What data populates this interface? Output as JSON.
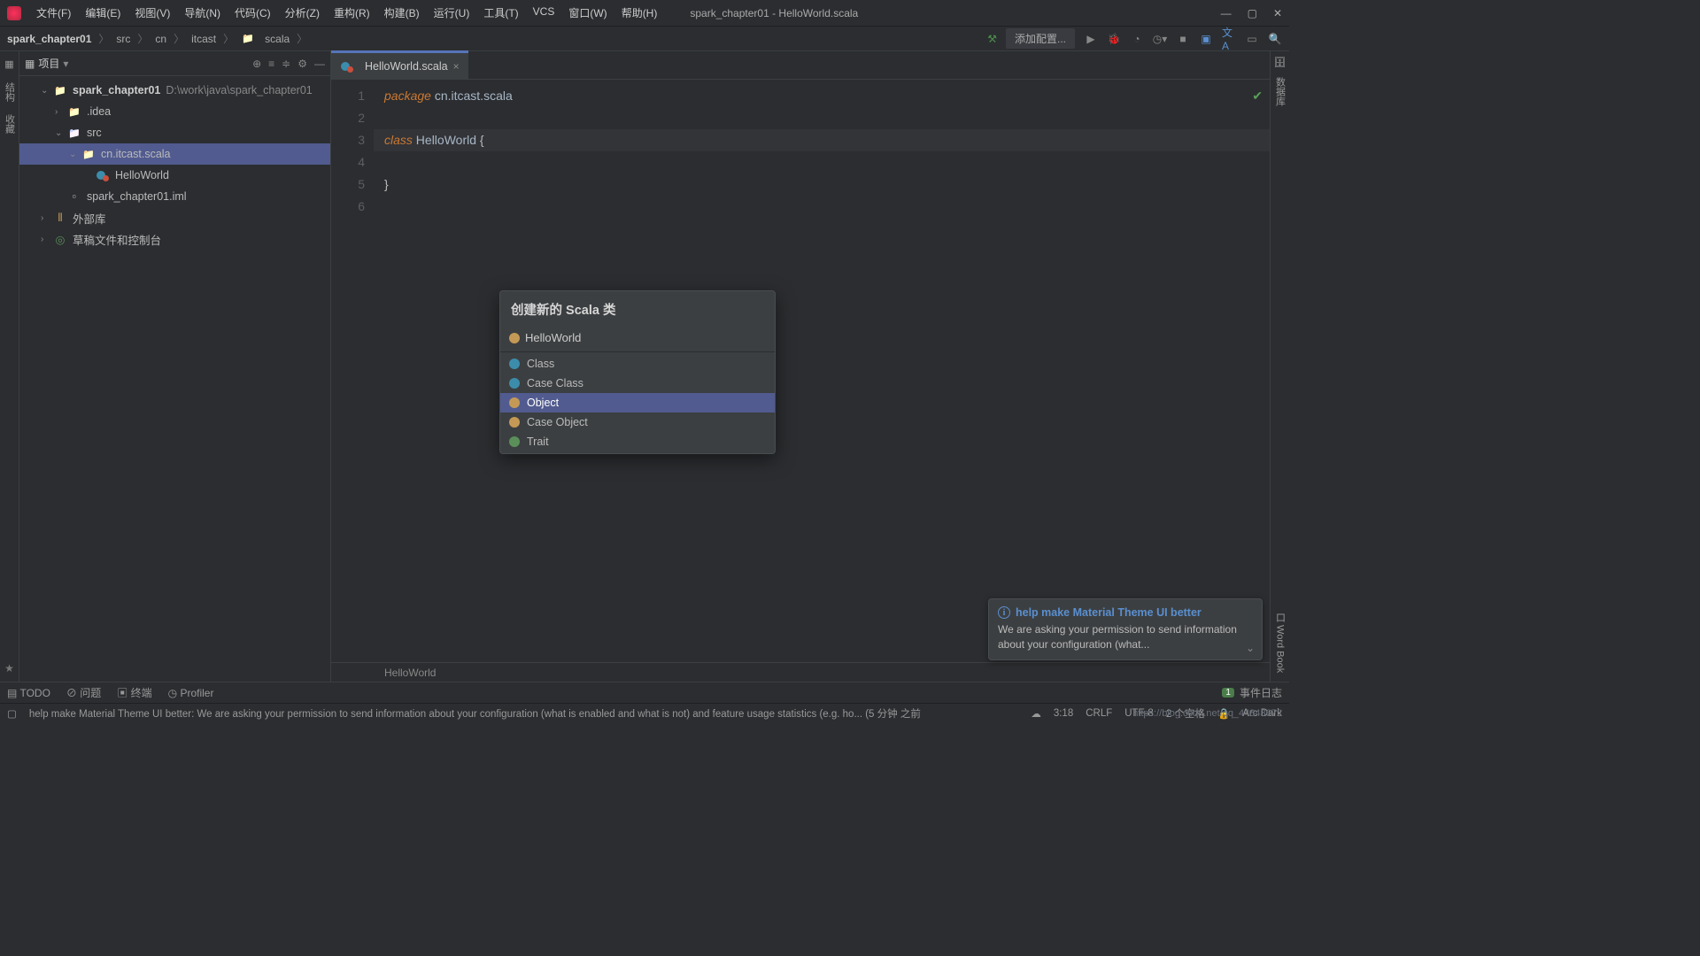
{
  "menubar": [
    "文件(F)",
    "编辑(E)",
    "视图(V)",
    "导航(N)",
    "代码(C)",
    "分析(Z)",
    "重构(R)",
    "构建(B)",
    "运行(U)",
    "工具(T)",
    "VCS",
    "窗口(W)",
    "帮助(H)"
  ],
  "window_title": "spark_chapter01 - HelloWorld.scala",
  "breadcrumb": [
    "spark_chapter01",
    "src",
    "cn",
    "itcast",
    "scala"
  ],
  "add_config": "添加配置...",
  "sidebar": {
    "title": "项目",
    "tree": {
      "root": "spark_chapter01",
      "root_path": "D:\\work\\java\\spark_chapter01",
      "idea": ".idea",
      "src": "src",
      "pkg": "cn.itcast.scala",
      "file1": "HelloWorld",
      "iml": "spark_chapter01.iml",
      "libs": "外部库",
      "scratch": "草稿文件和控制台"
    }
  },
  "tab_name": "HelloWorld.scala",
  "code": {
    "l1_kw": "package",
    "l1_rest": " cn.itcast.scala",
    "l3_kw": "class",
    "l3_name": " HelloWorld",
    "l3_brace": " {",
    "l5": "}"
  },
  "line_numbers": [
    "1",
    "2",
    "3",
    "4",
    "5",
    "6"
  ],
  "popup": {
    "title": "创建新的 Scala 类",
    "input_value": "HelloWorld",
    "items": [
      "Class",
      "Case Class",
      "Object",
      "Case Object",
      "Trait"
    ],
    "selected_index": 2
  },
  "bottom_crumb": "HelloWorld",
  "tool_bar": {
    "todo": "TODO",
    "problems": "问题",
    "terminal": "终端",
    "profiler": "Profiler",
    "event_log": "事件日志",
    "event_badge": "1"
  },
  "notification": {
    "title": "help make Material Theme UI better",
    "body": "We are asking your permission to send information about your configuration (what..."
  },
  "statusbar": {
    "msg": "help make Material Theme UI better: We are asking your permission to send information about your configuration (what is enabled and what is not) and feature usage statistics (e.g. ho... (5 分钟 之前",
    "pos": "3:18",
    "eol": "CRLF",
    "enc": "UTF-8",
    "indent": "2 个空格",
    "theme": "Arc Dark",
    "watermark": "https://blog.csdn.net/qq_44843672"
  },
  "left_gutter": [
    "项目",
    "结构",
    "收藏"
  ],
  "right_gutter": [
    "数据库",
    "口 Word Book"
  ]
}
